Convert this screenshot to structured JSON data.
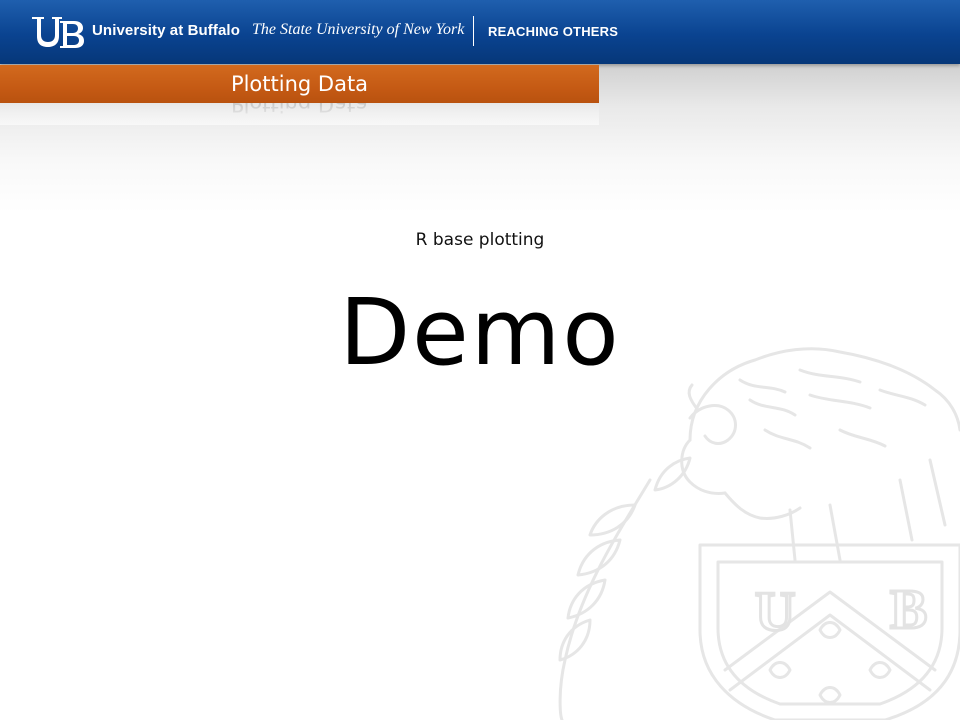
{
  "header": {
    "university_name": "University at Buffalo",
    "system_name": "The State University of New York",
    "tagline": "REACHING OTHERS",
    "logo_text": "UB",
    "colors": {
      "header_blue": "#0a4390",
      "title_orange": "#c55a14"
    }
  },
  "slide": {
    "title": "Plotting Data",
    "subtitle": "R base plotting",
    "main_text": "Demo"
  },
  "watermark": {
    "icon": "buffalo-seal-icon",
    "letters": [
      "U",
      "B"
    ]
  }
}
